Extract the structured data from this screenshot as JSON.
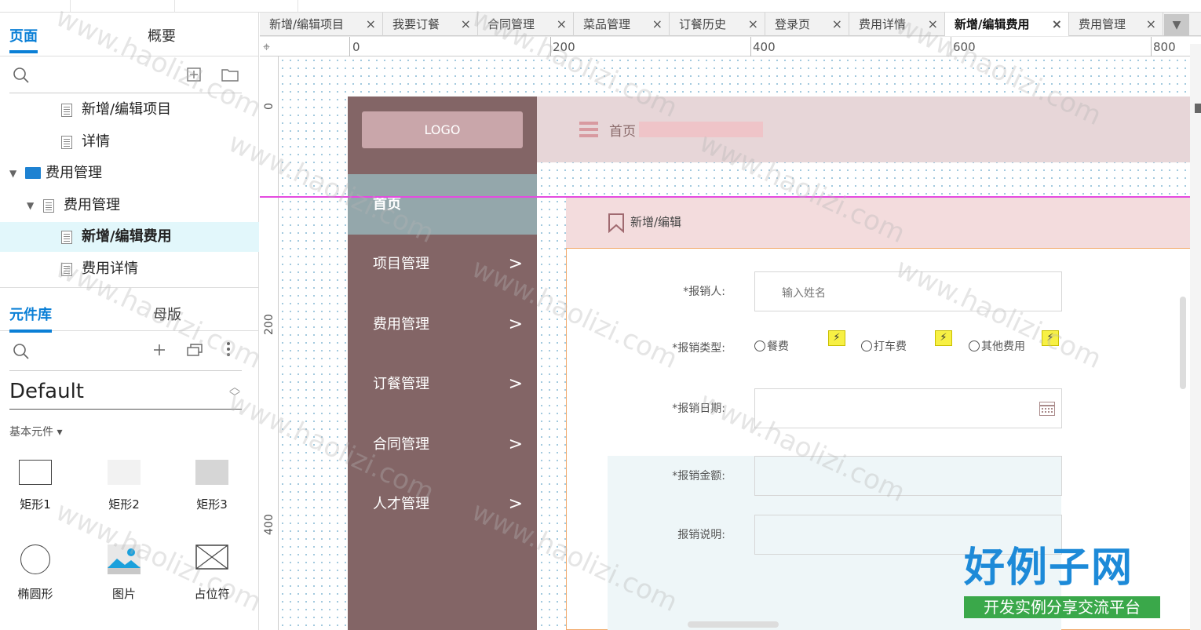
{
  "left_panel": {
    "tabs": {
      "pages": "页面",
      "overview": "概要"
    },
    "tree": [
      {
        "label": "新增/编辑项目",
        "type": "page"
      },
      {
        "label": "详情",
        "type": "page"
      },
      {
        "label": "费用管理",
        "type": "folder"
      },
      {
        "label": "费用管理",
        "type": "page"
      },
      {
        "label": "新增/编辑费用",
        "type": "page",
        "selected": true
      },
      {
        "label": "费用详情",
        "type": "page"
      }
    ],
    "lib_tabs": {
      "library": "元件库",
      "master": "母版"
    },
    "library_select": "Default",
    "basic_label": "基本元件 ▾",
    "widgets": [
      "矩形1",
      "矩形2",
      "矩形3",
      "椭圆形",
      "图片",
      "占位符"
    ]
  },
  "tabs": [
    {
      "label": "新增/编辑项目"
    },
    {
      "label": "我要订餐"
    },
    {
      "label": "合同管理"
    },
    {
      "label": "菜品管理"
    },
    {
      "label": "订餐历史"
    },
    {
      "label": "登录页"
    },
    {
      "label": "费用详情"
    },
    {
      "label": "新增/编辑费用",
      "active": true
    },
    {
      "label": "费用管理"
    }
  ],
  "ruler": {
    "h_labels": [
      "0",
      "200",
      "400",
      "600",
      "800"
    ],
    "v_labels": [
      "0",
      "200",
      "400"
    ]
  },
  "prototype": {
    "logo": "LOGO",
    "nav_home": "首页",
    "nav_items": [
      "项目管理",
      "费用管理",
      "订餐管理",
      "合同管理",
      "人才管理"
    ],
    "header_title": "首页",
    "breadcrumb": "新增/编辑",
    "form": {
      "reporter_label": "*报销人:",
      "reporter_placeholder": "输入姓名",
      "type_label": "*报销类型:",
      "type_options": [
        "餐费",
        "打车费",
        "其他费用"
      ],
      "date_label": "*报销日期:",
      "amount_label": "*报销金额:",
      "desc_label": "报销说明:"
    }
  },
  "watermark": "www.haolizi.com",
  "brand": {
    "title": "好例子网",
    "subtitle": "开发实例分享交流平台"
  },
  "colors": {
    "accent": "#0a7fd6",
    "sidebar": "#836566",
    "nav_active": "#94a7ab",
    "guide": "#e44be0"
  }
}
